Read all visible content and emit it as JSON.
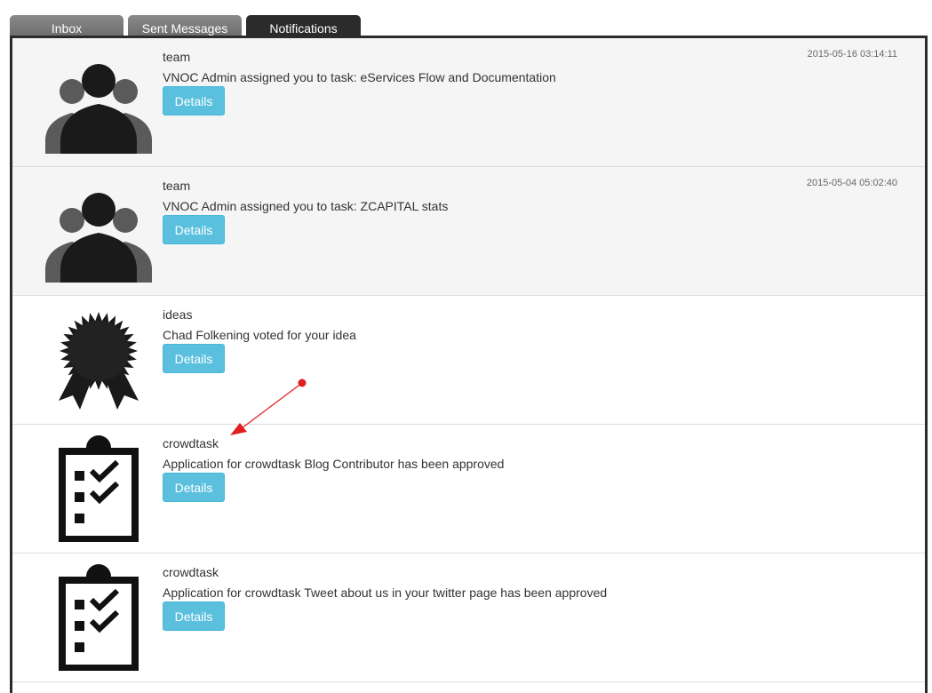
{
  "tabs": [
    {
      "label": "Inbox",
      "active": false
    },
    {
      "label": "Sent Messages",
      "active": false
    },
    {
      "label": "Notifications",
      "active": true
    }
  ],
  "colors": {
    "tab_active": "#2b2b2b",
    "tab_inactive": "#7c7c7c",
    "details_button": "#5bc0de",
    "row_shaded": "#f5f5f5",
    "arrow": "#e02020"
  },
  "notifications": [
    {
      "category": "team",
      "message": "VNOC Admin assigned you to task: eServices Flow and Documentation",
      "timestamp": "2015-05-16 03:14:11",
      "icon": "team-icon",
      "button": "Details"
    },
    {
      "category": "team",
      "message": "VNOC Admin assigned you to task: ZCAPITAL stats",
      "timestamp": "2015-05-04 05:02:40",
      "icon": "team-icon",
      "button": "Details"
    },
    {
      "category": "ideas",
      "message": "Chad Folkening voted for your idea",
      "timestamp": "",
      "icon": "award-ribbon-icon",
      "button": "Details"
    },
    {
      "category": "crowdtask",
      "message": "Application for crowdtask Blog Contributor has been approved",
      "timestamp": "",
      "icon": "clipboard-checklist-icon",
      "button": "Details"
    },
    {
      "category": "crowdtask",
      "message": "Application for crowdtask Tweet about us in your twitter page has been approved",
      "timestamp": "",
      "icon": "clipboard-checklist-icon",
      "button": "Details"
    }
  ]
}
